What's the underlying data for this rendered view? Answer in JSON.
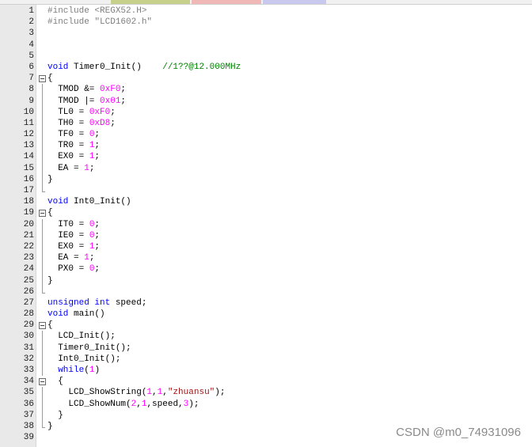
{
  "tab_strip_colors": [
    "#2a57b8",
    "#c7d08a",
    "#f0b7b7",
    "#c9c9f0"
  ],
  "lines": [
    {
      "n": "1",
      "fold": "",
      "tokens": [
        [
          "pp",
          "#include <REGX52.H>"
        ]
      ]
    },
    {
      "n": "2",
      "fold": "",
      "tokens": [
        [
          "pp",
          "#include \"LCD1602.h\""
        ]
      ]
    },
    {
      "n": "3",
      "fold": "",
      "tokens": []
    },
    {
      "n": "4",
      "fold": "",
      "tokens": []
    },
    {
      "n": "5",
      "fold": "",
      "tokens": []
    },
    {
      "n": "6",
      "fold": "",
      "tokens": [
        [
          "k",
          "void"
        ],
        [
          "",
          " Timer0_Init()    "
        ],
        [
          "cm",
          "//1??@12.000MHz"
        ]
      ]
    },
    {
      "n": "7",
      "fold": "box",
      "tokens": [
        [
          "",
          "{"
        ]
      ]
    },
    {
      "n": "8",
      "fold": "bar",
      "tokens": [
        [
          "",
          "  TMOD &= "
        ],
        [
          "nm",
          "0xF0"
        ],
        [
          "",
          ";"
        ]
      ]
    },
    {
      "n": "9",
      "fold": "bar",
      "tokens": [
        [
          "",
          "  TMOD |= "
        ],
        [
          "nm",
          "0x01"
        ],
        [
          "",
          ";"
        ]
      ]
    },
    {
      "n": "10",
      "fold": "bar",
      "tokens": [
        [
          "",
          "  TL0 = "
        ],
        [
          "nm",
          "0xF0"
        ],
        [
          "",
          ";"
        ]
      ]
    },
    {
      "n": "11",
      "fold": "bar",
      "tokens": [
        [
          "",
          "  TH0 = "
        ],
        [
          "nm",
          "0xD8"
        ],
        [
          "",
          ";"
        ]
      ]
    },
    {
      "n": "12",
      "fold": "bar",
      "tokens": [
        [
          "",
          "  TF0 = "
        ],
        [
          "nm",
          "0"
        ],
        [
          "",
          ";"
        ]
      ]
    },
    {
      "n": "13",
      "fold": "bar",
      "tokens": [
        [
          "",
          "  TR0 = "
        ],
        [
          "nm",
          "1"
        ],
        [
          "",
          ";"
        ]
      ]
    },
    {
      "n": "14",
      "fold": "bar",
      "tokens": [
        [
          "",
          "  EX0 = "
        ],
        [
          "nm",
          "1"
        ],
        [
          "",
          ";"
        ]
      ]
    },
    {
      "n": "15",
      "fold": "bar",
      "tokens": [
        [
          "",
          "  EA = "
        ],
        [
          "nm",
          "1"
        ],
        [
          "",
          ";"
        ]
      ]
    },
    {
      "n": "16",
      "fold": "bar",
      "tokens": [
        [
          "",
          "}"
        ]
      ]
    },
    {
      "n": "17",
      "fold": "end",
      "tokens": []
    },
    {
      "n": "18",
      "fold": "",
      "tokens": [
        [
          "k",
          "void"
        ],
        [
          "",
          " Int0_Init()"
        ]
      ]
    },
    {
      "n": "19",
      "fold": "box",
      "tokens": [
        [
          "",
          "{"
        ]
      ]
    },
    {
      "n": "20",
      "fold": "bar",
      "tokens": [
        [
          "",
          "  IT0 = "
        ],
        [
          "nm",
          "0"
        ],
        [
          "",
          ";"
        ]
      ]
    },
    {
      "n": "21",
      "fold": "bar",
      "tokens": [
        [
          "",
          "  IE0 = "
        ],
        [
          "nm",
          "0"
        ],
        [
          "",
          ";"
        ]
      ]
    },
    {
      "n": "22",
      "fold": "bar",
      "tokens": [
        [
          "",
          "  EX0 = "
        ],
        [
          "nm",
          "1"
        ],
        [
          "",
          ";"
        ]
      ]
    },
    {
      "n": "23",
      "fold": "bar",
      "tokens": [
        [
          "",
          "  EA = "
        ],
        [
          "nm",
          "1"
        ],
        [
          "",
          ";"
        ]
      ]
    },
    {
      "n": "24",
      "fold": "bar",
      "tokens": [
        [
          "",
          "  PX0 = "
        ],
        [
          "nm",
          "0"
        ],
        [
          "",
          ";"
        ]
      ]
    },
    {
      "n": "25",
      "fold": "bar",
      "tokens": [
        [
          "",
          "}"
        ]
      ]
    },
    {
      "n": "26",
      "fold": "end",
      "tokens": []
    },
    {
      "n": "27",
      "fold": "",
      "tokens": [
        [
          "k",
          "unsigned int"
        ],
        [
          "",
          " speed;"
        ]
      ]
    },
    {
      "n": "28",
      "fold": "",
      "tokens": [
        [
          "k",
          "void"
        ],
        [
          "",
          " main()"
        ]
      ]
    },
    {
      "n": "29",
      "fold": "box",
      "tokens": [
        [
          "",
          "{"
        ]
      ]
    },
    {
      "n": "30",
      "fold": "bar",
      "tokens": [
        [
          "",
          "  LCD_Init();"
        ]
      ]
    },
    {
      "n": "31",
      "fold": "bar",
      "tokens": [
        [
          "",
          "  Timer0_Init();"
        ]
      ]
    },
    {
      "n": "32",
      "fold": "bar",
      "tokens": [
        [
          "",
          "  Int0_Init();"
        ]
      ]
    },
    {
      "n": "33",
      "fold": "bar",
      "tokens": [
        [
          "",
          "  "
        ],
        [
          "k",
          "while"
        ],
        [
          "",
          "("
        ],
        [
          "nm",
          "1"
        ],
        [
          "",
          ")"
        ]
      ]
    },
    {
      "n": "34",
      "fold": "box",
      "tokens": [
        [
          "",
          "  {"
        ]
      ]
    },
    {
      "n": "35",
      "fold": "bar",
      "tokens": [
        [
          "",
          "    LCD_ShowString("
        ],
        [
          "nm",
          "1"
        ],
        [
          "",
          ","
        ],
        [
          "nm",
          "1"
        ],
        [
          "",
          ","
        ],
        [
          "str",
          "\"zhuansu\""
        ],
        [
          "",
          ");"
        ]
      ]
    },
    {
      "n": "36",
      "fold": "bar",
      "tokens": [
        [
          "",
          "    LCD_ShowNum("
        ],
        [
          "nm",
          "2"
        ],
        [
          "",
          ","
        ],
        [
          "nm",
          "1"
        ],
        [
          "",
          ",speed,"
        ],
        [
          "nm",
          "3"
        ],
        [
          "",
          ");"
        ]
      ]
    },
    {
      "n": "37",
      "fold": "bar",
      "tokens": [
        [
          "",
          "  }"
        ]
      ]
    },
    {
      "n": "38",
      "fold": "end",
      "tokens": [
        [
          "",
          "}"
        ]
      ]
    },
    {
      "n": "39",
      "fold": "",
      "tokens": []
    }
  ],
  "watermark": "CSDN @m0_74931096"
}
